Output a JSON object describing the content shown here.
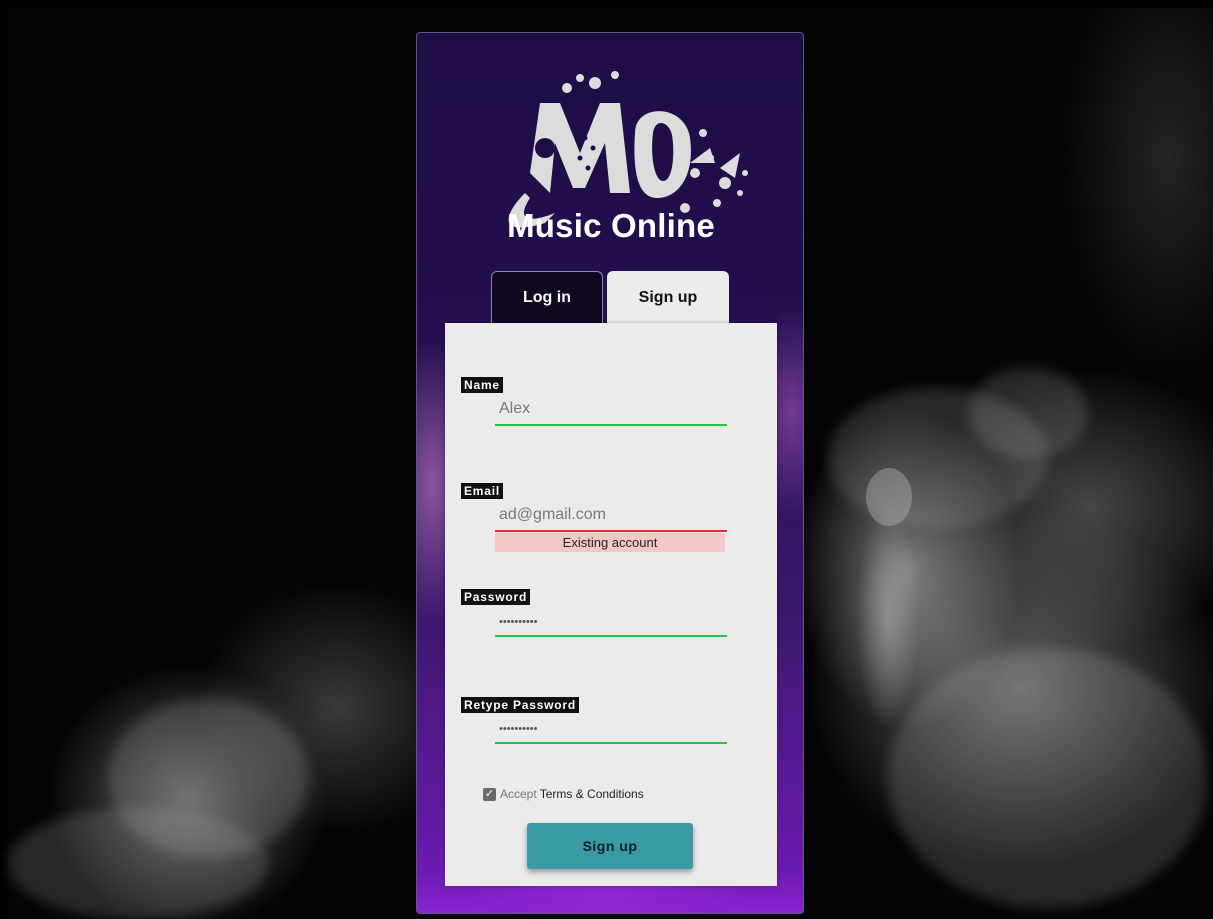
{
  "brand": {
    "title": "Music Online",
    "logo_icon": "mo-music-logo-icon"
  },
  "tabs": [
    {
      "label": "Log in",
      "active": false
    },
    {
      "label": "Sign up",
      "active": true
    }
  ],
  "form": {
    "name": {
      "label": "Name",
      "value": "Alex",
      "status": "valid"
    },
    "email": {
      "label": "Email",
      "value": "ad@gmail.com",
      "status": "invalid",
      "error": "Existing account"
    },
    "password": {
      "label": "Password",
      "value": "••••••••••",
      "status": "valid"
    },
    "retype": {
      "label": "Retype Password",
      "value": "••••••••••",
      "status": "valid"
    },
    "accept": {
      "checked": true,
      "prefix": "Accept",
      "link": "Terms & Conditions"
    },
    "submit_label": "Sign up"
  },
  "colors": {
    "valid": "#26c24a",
    "invalid": "#e53030",
    "button": "#3a9aa6"
  }
}
